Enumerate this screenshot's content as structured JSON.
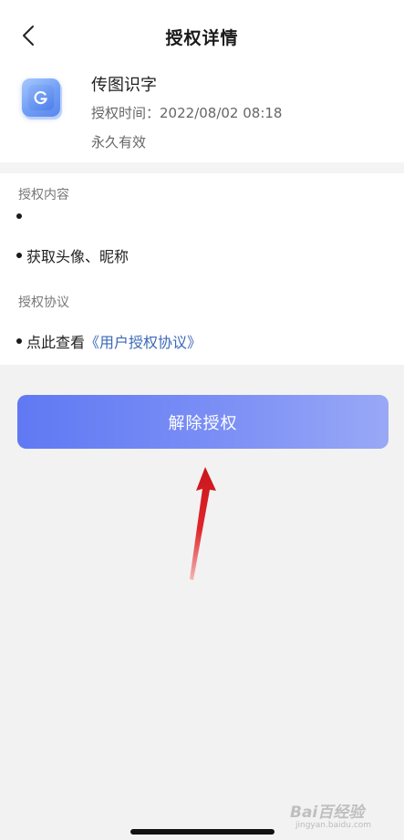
{
  "header": {
    "title": "授权详情",
    "back_icon": "chevron-left-icon"
  },
  "app": {
    "name": "传图识字",
    "auth_time_label": "授权时间：",
    "auth_time_value": "2022/08/02 08:18",
    "validity": "永久有效",
    "icon_letter": "G"
  },
  "content": {
    "scope_title": "授权内容",
    "scope_items": [
      "",
      "获取头像、昵称"
    ],
    "agreement_title": "授权协议",
    "agreement_prefix": "点此查看",
    "agreement_link": "《用户授权协议》"
  },
  "actions": {
    "revoke_label": "解除授权"
  },
  "watermark": {
    "brand": "Bai百经验",
    "site": "jingyan.baidu.com"
  },
  "colors": {
    "primary_gradient_start": "#6079f3",
    "primary_gradient_end": "#99a8f6",
    "link": "#3a68b8",
    "annotation_arrow": "#e0262a"
  }
}
